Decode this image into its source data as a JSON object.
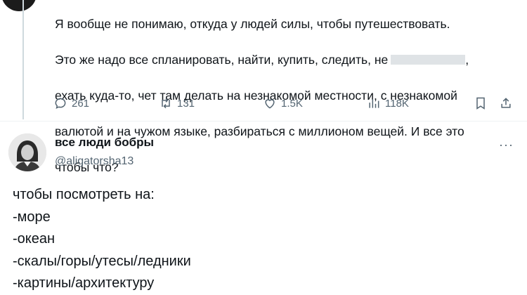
{
  "tweet": {
    "lines": [
      "Я вообще не понимаю, откуда у людей силы, чтобы путешествовать.",
      "Это же надо все спланировать, найти, купить, следить, не",
      "ехать куда-то, чет там делать на незнакомой местности, с незнакомой",
      "валютой и на чужом языке, разбираться с миллионом вещей. И все это",
      "чтобы что?"
    ],
    "line2_suffix": ",",
    "stats": {
      "replies": "261",
      "retweets": "131",
      "likes": "1.5K",
      "views": "118K"
    },
    "icons": [
      "reply-icon",
      "retweet-icon",
      "like-icon",
      "views-icon",
      "bookmark-icon",
      "share-icon"
    ]
  },
  "reply": {
    "display_name": "все люди бобры",
    "handle": "@aligatorsha13",
    "more": "···",
    "lines": [
      "чтобы посмотреть на:",
      "-море",
      "-океан",
      "-скалы/горы/утесы/ледники",
      "-картины/архитектуру"
    ]
  }
}
